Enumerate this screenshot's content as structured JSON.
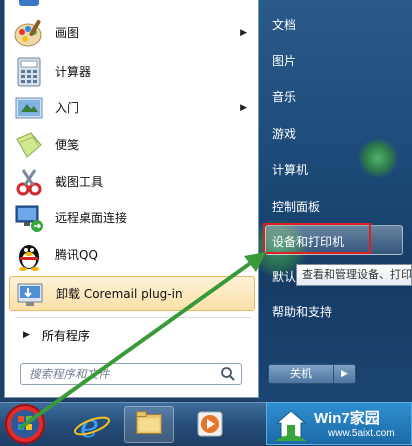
{
  "left_items": [
    {
      "label": "画图",
      "icon": "paint-icon",
      "submenu": true
    },
    {
      "label": "计算器",
      "icon": "calculator-icon",
      "submenu": false
    },
    {
      "label": "入门",
      "icon": "getting-started-icon",
      "submenu": true
    },
    {
      "label": "便笺",
      "icon": "sticky-notes-icon",
      "submenu": false
    },
    {
      "label": "截图工具",
      "icon": "snipping-tool-icon",
      "submenu": false
    },
    {
      "label": "远程桌面连接",
      "icon": "remote-desktop-icon",
      "submenu": false
    },
    {
      "label": "腾讯QQ",
      "icon": "qq-penguin-icon",
      "submenu": false
    },
    {
      "label": "卸载 Coremail plug-in",
      "icon": "uninstall-icon",
      "submenu": false
    }
  ],
  "all_programs": "所有程序",
  "search": {
    "placeholder": "搜索程序和文件"
  },
  "right_items": {
    "documents": "文档",
    "pictures": "图片",
    "music": "音乐",
    "games": "游戏",
    "computer": "计算机",
    "control_panel": "控制面板",
    "devices_printers": "设备和打印机",
    "default_programs": "默认",
    "help_support": "帮助和支持"
  },
  "tooltip": "查看和管理设备、打印机",
  "shutdown_label": "关机",
  "watermark": {
    "title": "Win7家园",
    "url": "www.5aixt.com"
  },
  "colors": {
    "highlight_border": "#e02020",
    "arrow": "#3a9a3a"
  }
}
